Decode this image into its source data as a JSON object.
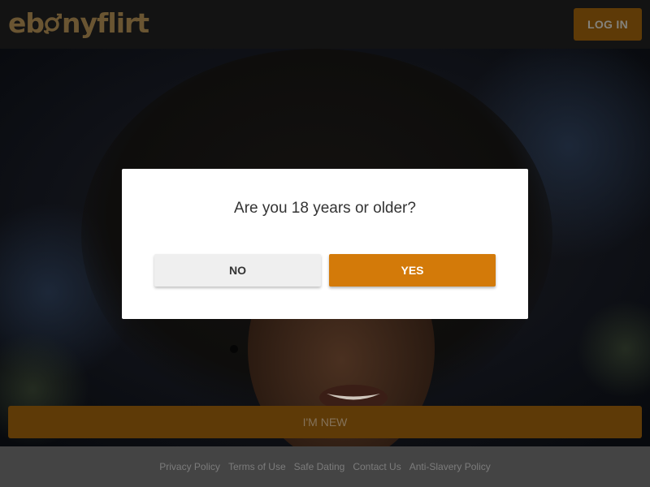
{
  "header": {
    "logo": {
      "part1": "eb",
      "part2": "nyflirt"
    },
    "login_label": "LOG IN"
  },
  "modal": {
    "question": "Are you 18 years or older?",
    "no_label": "NO",
    "yes_label": "YES"
  },
  "new_button_label": "I'M NEW",
  "footer": {
    "links": [
      "Privacy Policy",
      "Terms of Use",
      "Safe Dating",
      "Contact Us",
      "Anti-Slavery Policy"
    ]
  },
  "colors": {
    "accent": "#d37a09",
    "accent_dim": "#5e3a07",
    "header_bg": "#131313",
    "footer_bg": "#444444"
  }
}
